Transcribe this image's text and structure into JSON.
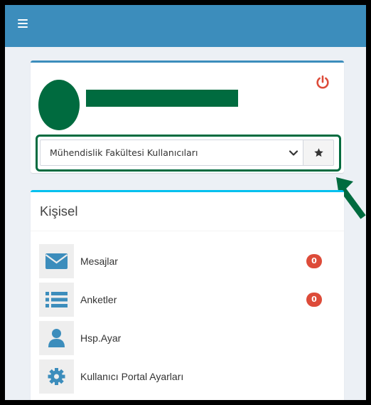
{
  "header": {
    "menu_icon": "hamburger-icon",
    "background_color": "#3c8dbc"
  },
  "profile": {
    "avatar_color": "#006b3f",
    "name_redaction_color": "#006b3f",
    "logout_icon": "power-icon",
    "logout_icon_color": "#dd4b39",
    "role_select": {
      "selected_value": "Mühendislik Fakültesi Kullanıcıları"
    },
    "favorite_icon": "star-icon",
    "highlight_color": "#006b3f"
  },
  "annotation": {
    "arrow_icon": "arrow-icon",
    "color": "#006b3f"
  },
  "personal": {
    "title": "Kişisel",
    "accent_color": "#00c0ef",
    "items": [
      {
        "label": "Mesajlar",
        "icon": "envelope-icon",
        "badge": "0"
      },
      {
        "label": "Anketler",
        "icon": "list-icon",
        "badge": "0"
      },
      {
        "label": "Hsp.Ayar",
        "icon": "user-icon"
      },
      {
        "label": "Kullanıcı Portal Ayarları",
        "icon": "gear-icon"
      }
    ],
    "icon_color": "#3c8dbc",
    "badge_color": "#dd4b39"
  }
}
